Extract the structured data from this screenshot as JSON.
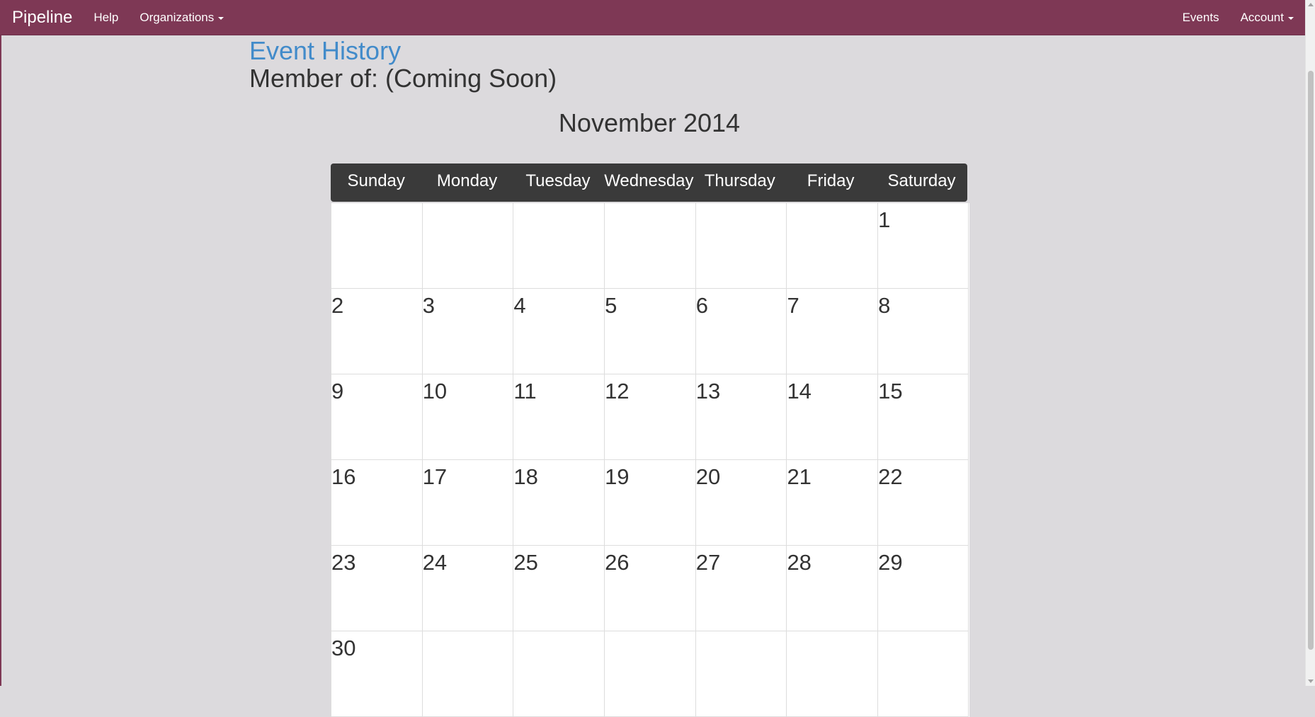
{
  "app": {
    "brand": "Pipeline",
    "accent_color": "#7e3855",
    "link_color": "#428bca"
  },
  "nav": {
    "left": [
      {
        "label": "Help",
        "has_caret": false
      },
      {
        "label": "Organizations",
        "has_caret": true
      }
    ],
    "right": [
      {
        "label": "Events",
        "has_caret": false
      },
      {
        "label": "Account",
        "has_caret": true
      }
    ]
  },
  "page": {
    "event_history_link": "Event History",
    "member_of": "Member of: (Coming Soon)"
  },
  "calendar": {
    "title": "November 2014",
    "weekdays": [
      "Sunday",
      "Monday",
      "Tuesday",
      "Wednesday",
      "Thursday",
      "Friday",
      "Saturday"
    ],
    "weeks": [
      [
        "",
        "",
        "",
        "",
        "",
        "",
        "1"
      ],
      [
        "2",
        "3",
        "4",
        "5",
        "6",
        "7",
        "8"
      ],
      [
        "9",
        "10",
        "11",
        "12",
        "13",
        "14",
        "15"
      ],
      [
        "16",
        "17",
        "18",
        "19",
        "20",
        "21",
        "22"
      ],
      [
        "23",
        "24",
        "25",
        "26",
        "27",
        "28",
        "29"
      ],
      [
        "30",
        "",
        "",
        "",
        "",
        "",
        ""
      ]
    ]
  }
}
